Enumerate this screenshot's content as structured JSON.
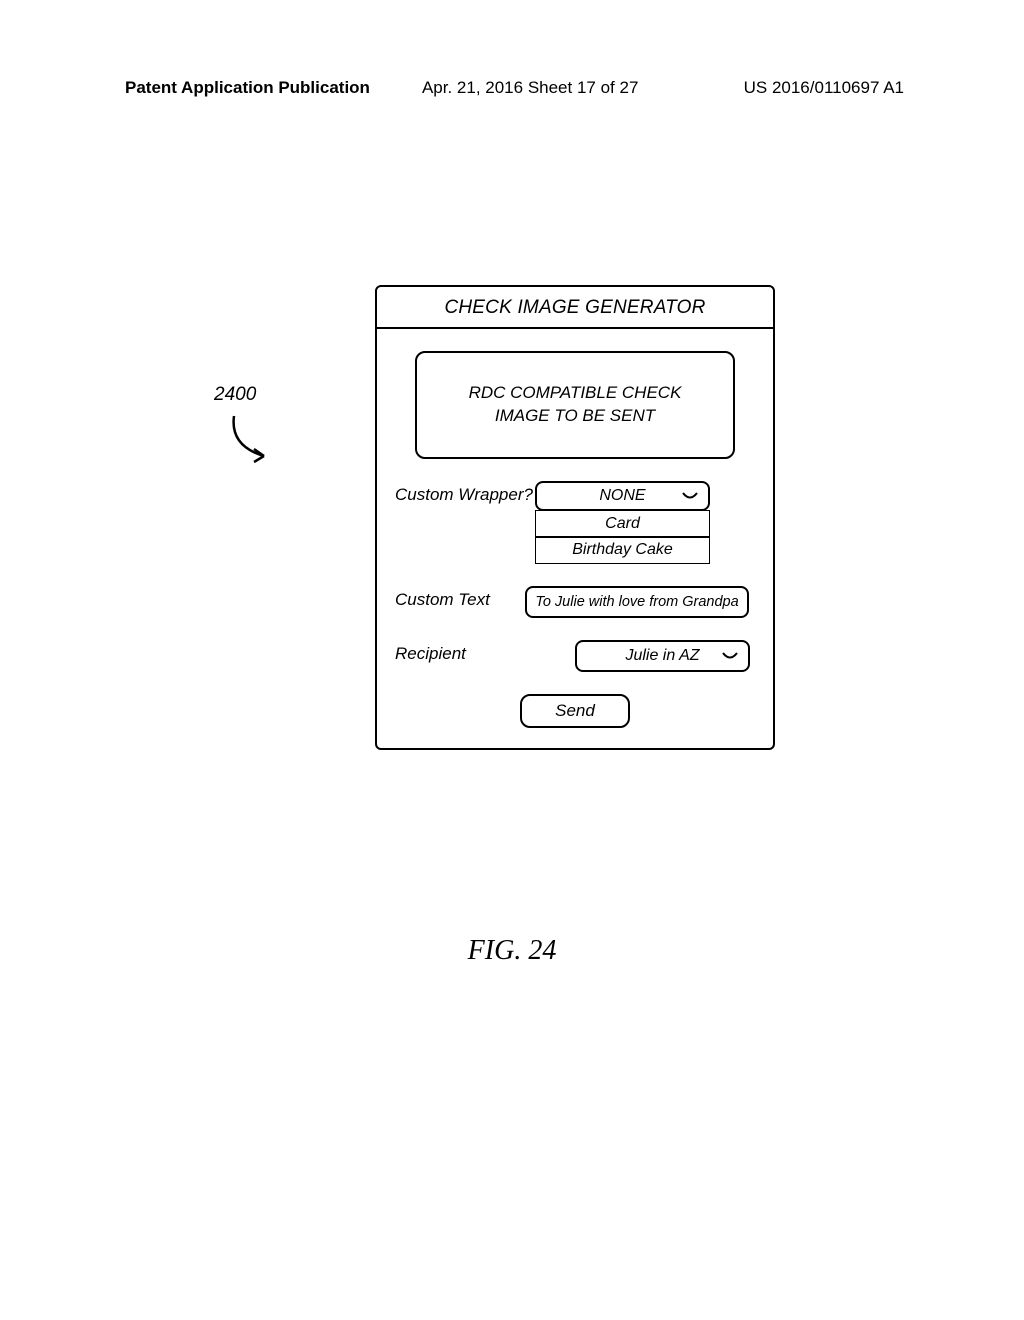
{
  "header": {
    "left": "Patent Application Publication",
    "mid": "Apr. 21, 2016  Sheet 17 of 27",
    "right": "US 2016/0110697 A1"
  },
  "figure_ref": "2400",
  "device": {
    "title": "CHECK IMAGE GENERATOR",
    "preview": "RDC COMPATIBLE CHECK\nIMAGE TO BE SENT",
    "wrapper": {
      "label": "Custom Wrapper?",
      "selected": "NONE",
      "options": [
        "Card",
        "Birthday Cake"
      ]
    },
    "custom_text": {
      "label": "Custom Text",
      "value": "To Julie with love from Grandpa"
    },
    "recipient": {
      "label": "Recipient",
      "value": "Julie in AZ"
    },
    "send_label": "Send"
  },
  "caption": "FIG. 24"
}
